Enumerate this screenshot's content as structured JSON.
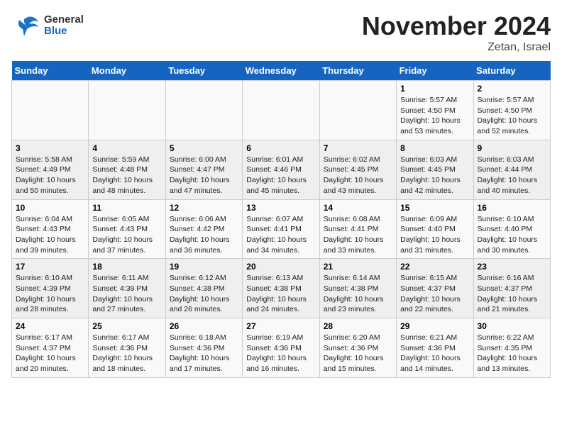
{
  "header": {
    "logo_general": "General",
    "logo_blue": "Blue",
    "month": "November 2024",
    "location": "Zetan, Israel"
  },
  "days_of_week": [
    "Sunday",
    "Monday",
    "Tuesday",
    "Wednesday",
    "Thursday",
    "Friday",
    "Saturday"
  ],
  "weeks": [
    [
      {
        "day": "",
        "detail": ""
      },
      {
        "day": "",
        "detail": ""
      },
      {
        "day": "",
        "detail": ""
      },
      {
        "day": "",
        "detail": ""
      },
      {
        "day": "",
        "detail": ""
      },
      {
        "day": "1",
        "detail": "Sunrise: 5:57 AM\nSunset: 4:50 PM\nDaylight: 10 hours and 53 minutes."
      },
      {
        "day": "2",
        "detail": "Sunrise: 5:57 AM\nSunset: 4:50 PM\nDaylight: 10 hours and 52 minutes."
      }
    ],
    [
      {
        "day": "3",
        "detail": "Sunrise: 5:58 AM\nSunset: 4:49 PM\nDaylight: 10 hours and 50 minutes."
      },
      {
        "day": "4",
        "detail": "Sunrise: 5:59 AM\nSunset: 4:48 PM\nDaylight: 10 hours and 48 minutes."
      },
      {
        "day": "5",
        "detail": "Sunrise: 6:00 AM\nSunset: 4:47 PM\nDaylight: 10 hours and 47 minutes."
      },
      {
        "day": "6",
        "detail": "Sunrise: 6:01 AM\nSunset: 4:46 PM\nDaylight: 10 hours and 45 minutes."
      },
      {
        "day": "7",
        "detail": "Sunrise: 6:02 AM\nSunset: 4:45 PM\nDaylight: 10 hours and 43 minutes."
      },
      {
        "day": "8",
        "detail": "Sunrise: 6:03 AM\nSunset: 4:45 PM\nDaylight: 10 hours and 42 minutes."
      },
      {
        "day": "9",
        "detail": "Sunrise: 6:03 AM\nSunset: 4:44 PM\nDaylight: 10 hours and 40 minutes."
      }
    ],
    [
      {
        "day": "10",
        "detail": "Sunrise: 6:04 AM\nSunset: 4:43 PM\nDaylight: 10 hours and 39 minutes."
      },
      {
        "day": "11",
        "detail": "Sunrise: 6:05 AM\nSunset: 4:43 PM\nDaylight: 10 hours and 37 minutes."
      },
      {
        "day": "12",
        "detail": "Sunrise: 6:06 AM\nSunset: 4:42 PM\nDaylight: 10 hours and 36 minutes."
      },
      {
        "day": "13",
        "detail": "Sunrise: 6:07 AM\nSunset: 4:41 PM\nDaylight: 10 hours and 34 minutes."
      },
      {
        "day": "14",
        "detail": "Sunrise: 6:08 AM\nSunset: 4:41 PM\nDaylight: 10 hours and 33 minutes."
      },
      {
        "day": "15",
        "detail": "Sunrise: 6:09 AM\nSunset: 4:40 PM\nDaylight: 10 hours and 31 minutes."
      },
      {
        "day": "16",
        "detail": "Sunrise: 6:10 AM\nSunset: 4:40 PM\nDaylight: 10 hours and 30 minutes."
      }
    ],
    [
      {
        "day": "17",
        "detail": "Sunrise: 6:10 AM\nSunset: 4:39 PM\nDaylight: 10 hours and 28 minutes."
      },
      {
        "day": "18",
        "detail": "Sunrise: 6:11 AM\nSunset: 4:39 PM\nDaylight: 10 hours and 27 minutes."
      },
      {
        "day": "19",
        "detail": "Sunrise: 6:12 AM\nSunset: 4:38 PM\nDaylight: 10 hours and 26 minutes."
      },
      {
        "day": "20",
        "detail": "Sunrise: 6:13 AM\nSunset: 4:38 PM\nDaylight: 10 hours and 24 minutes."
      },
      {
        "day": "21",
        "detail": "Sunrise: 6:14 AM\nSunset: 4:38 PM\nDaylight: 10 hours and 23 minutes."
      },
      {
        "day": "22",
        "detail": "Sunrise: 6:15 AM\nSunset: 4:37 PM\nDaylight: 10 hours and 22 minutes."
      },
      {
        "day": "23",
        "detail": "Sunrise: 6:16 AM\nSunset: 4:37 PM\nDaylight: 10 hours and 21 minutes."
      }
    ],
    [
      {
        "day": "24",
        "detail": "Sunrise: 6:17 AM\nSunset: 4:37 PM\nDaylight: 10 hours and 20 minutes."
      },
      {
        "day": "25",
        "detail": "Sunrise: 6:17 AM\nSunset: 4:36 PM\nDaylight: 10 hours and 18 minutes."
      },
      {
        "day": "26",
        "detail": "Sunrise: 6:18 AM\nSunset: 4:36 PM\nDaylight: 10 hours and 17 minutes."
      },
      {
        "day": "27",
        "detail": "Sunrise: 6:19 AM\nSunset: 4:36 PM\nDaylight: 10 hours and 16 minutes."
      },
      {
        "day": "28",
        "detail": "Sunrise: 6:20 AM\nSunset: 4:36 PM\nDaylight: 10 hours and 15 minutes."
      },
      {
        "day": "29",
        "detail": "Sunrise: 6:21 AM\nSunset: 4:36 PM\nDaylight: 10 hours and 14 minutes."
      },
      {
        "day": "30",
        "detail": "Sunrise: 6:22 AM\nSunset: 4:35 PM\nDaylight: 10 hours and 13 minutes."
      }
    ]
  ]
}
